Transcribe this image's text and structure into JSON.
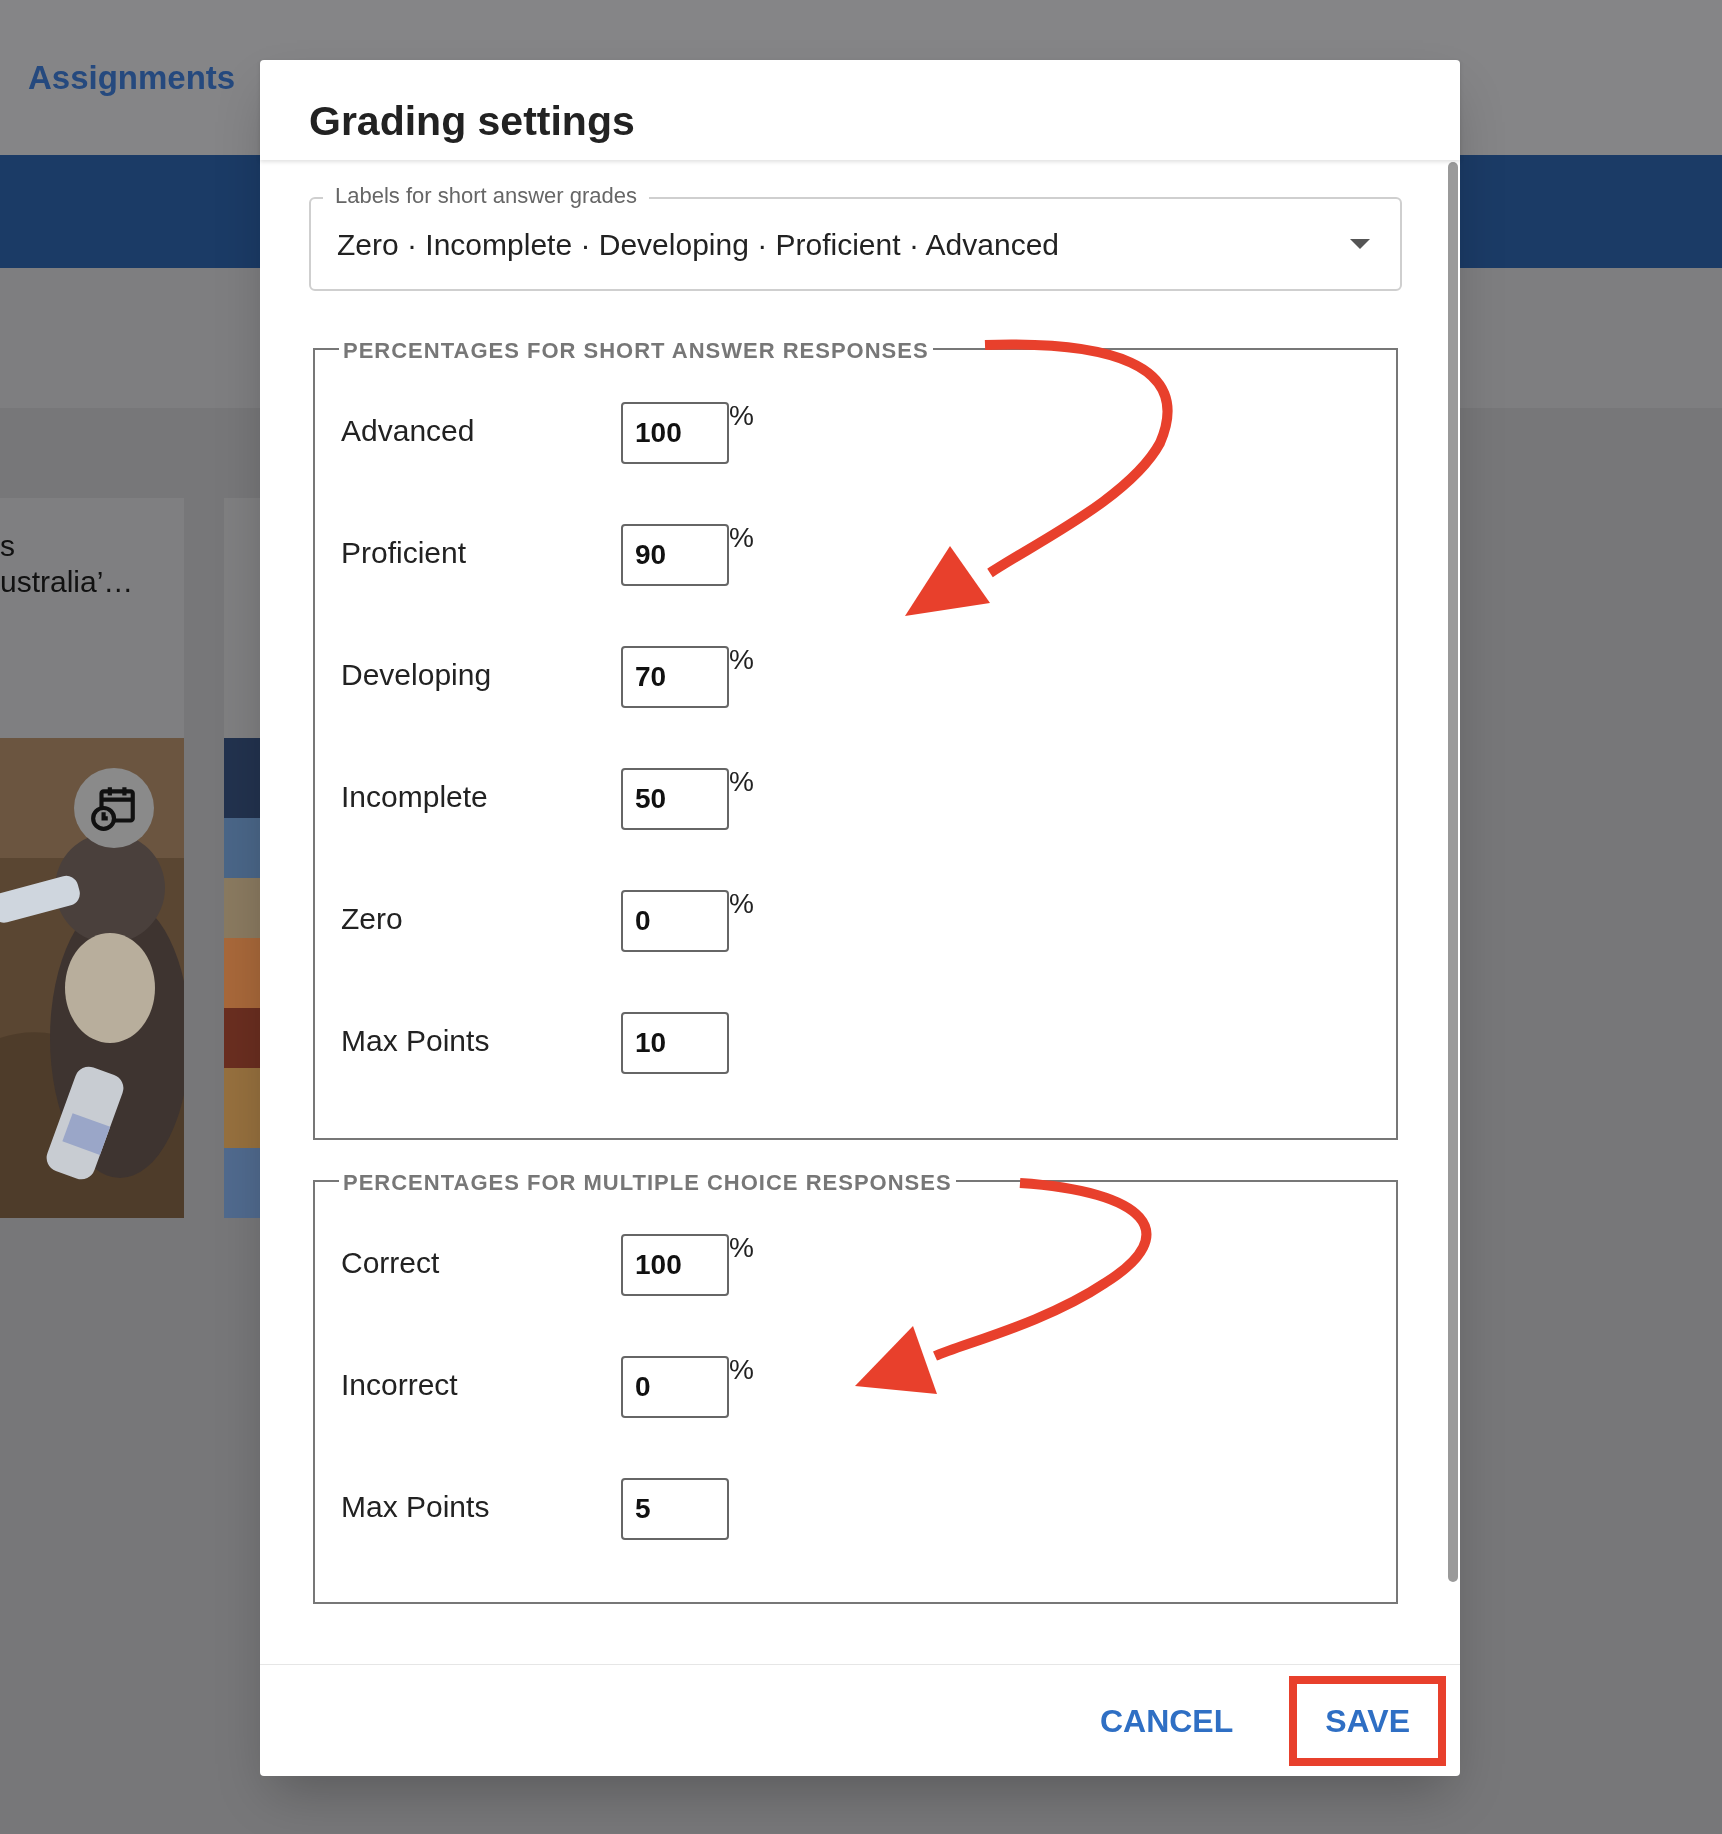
{
  "page": {
    "title": "Assignments",
    "cards": [
      {
        "title_lines": [
          "s",
          "ustralia’…"
        ],
        "has_schedule": true,
        "kind": "picture"
      },
      {
        "kind": "picture"
      }
    ]
  },
  "dialog": {
    "title": "Grading settings",
    "labels_select": {
      "label": "Labels for short answer grades",
      "value": "Zero · Incomplete · Developing · Proficient · Advanced"
    },
    "sections": [
      {
        "legend": "PERCENTAGES FOR SHORT ANSWER RESPONSES",
        "rows": [
          {
            "label": "Advanced",
            "value": "100",
            "unit": "%"
          },
          {
            "label": "Proficient",
            "value": "90",
            "unit": "%"
          },
          {
            "label": "Developing",
            "value": "70",
            "unit": "%"
          },
          {
            "label": "Incomplete",
            "value": "50",
            "unit": "%"
          },
          {
            "label": "Zero",
            "value": "0",
            "unit": "%"
          },
          {
            "label": "Max Points",
            "value": "10"
          }
        ]
      },
      {
        "legend": "PERCENTAGES FOR MULTIPLE CHOICE RESPONSES",
        "rows": [
          {
            "label": "Correct",
            "value": "100",
            "unit": "%"
          },
          {
            "label": "Incorrect",
            "value": "0",
            "unit": "%"
          },
          {
            "label": "Max Points",
            "value": "5"
          }
        ]
      }
    ],
    "buttons": [
      {
        "label": "CANCEL",
        "highlighted": false
      },
      {
        "label": "SAVE",
        "highlighted": true
      }
    ]
  }
}
